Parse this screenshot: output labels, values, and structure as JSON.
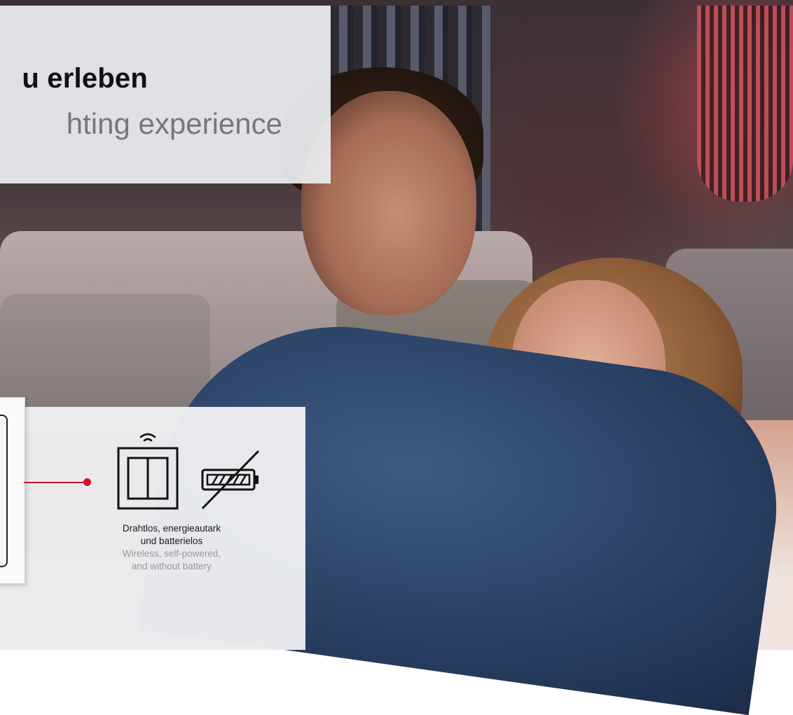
{
  "headline": {
    "german": "u erleben",
    "english": "hting experience"
  },
  "feature": {
    "german_line1": "Drahtlos, energieautark",
    "german_line2": "und batterielos",
    "english_line1": "Wireless, self-powered,",
    "english_line2": "and without battery"
  },
  "icons": [
    "wifi-signal-icon",
    "double-light-switch-icon",
    "crossed-out-battery-icon"
  ],
  "colors": {
    "accent": "#d0142a",
    "panel": "#eceef1",
    "text_dark": "#111111",
    "text_muted": "#999999"
  }
}
